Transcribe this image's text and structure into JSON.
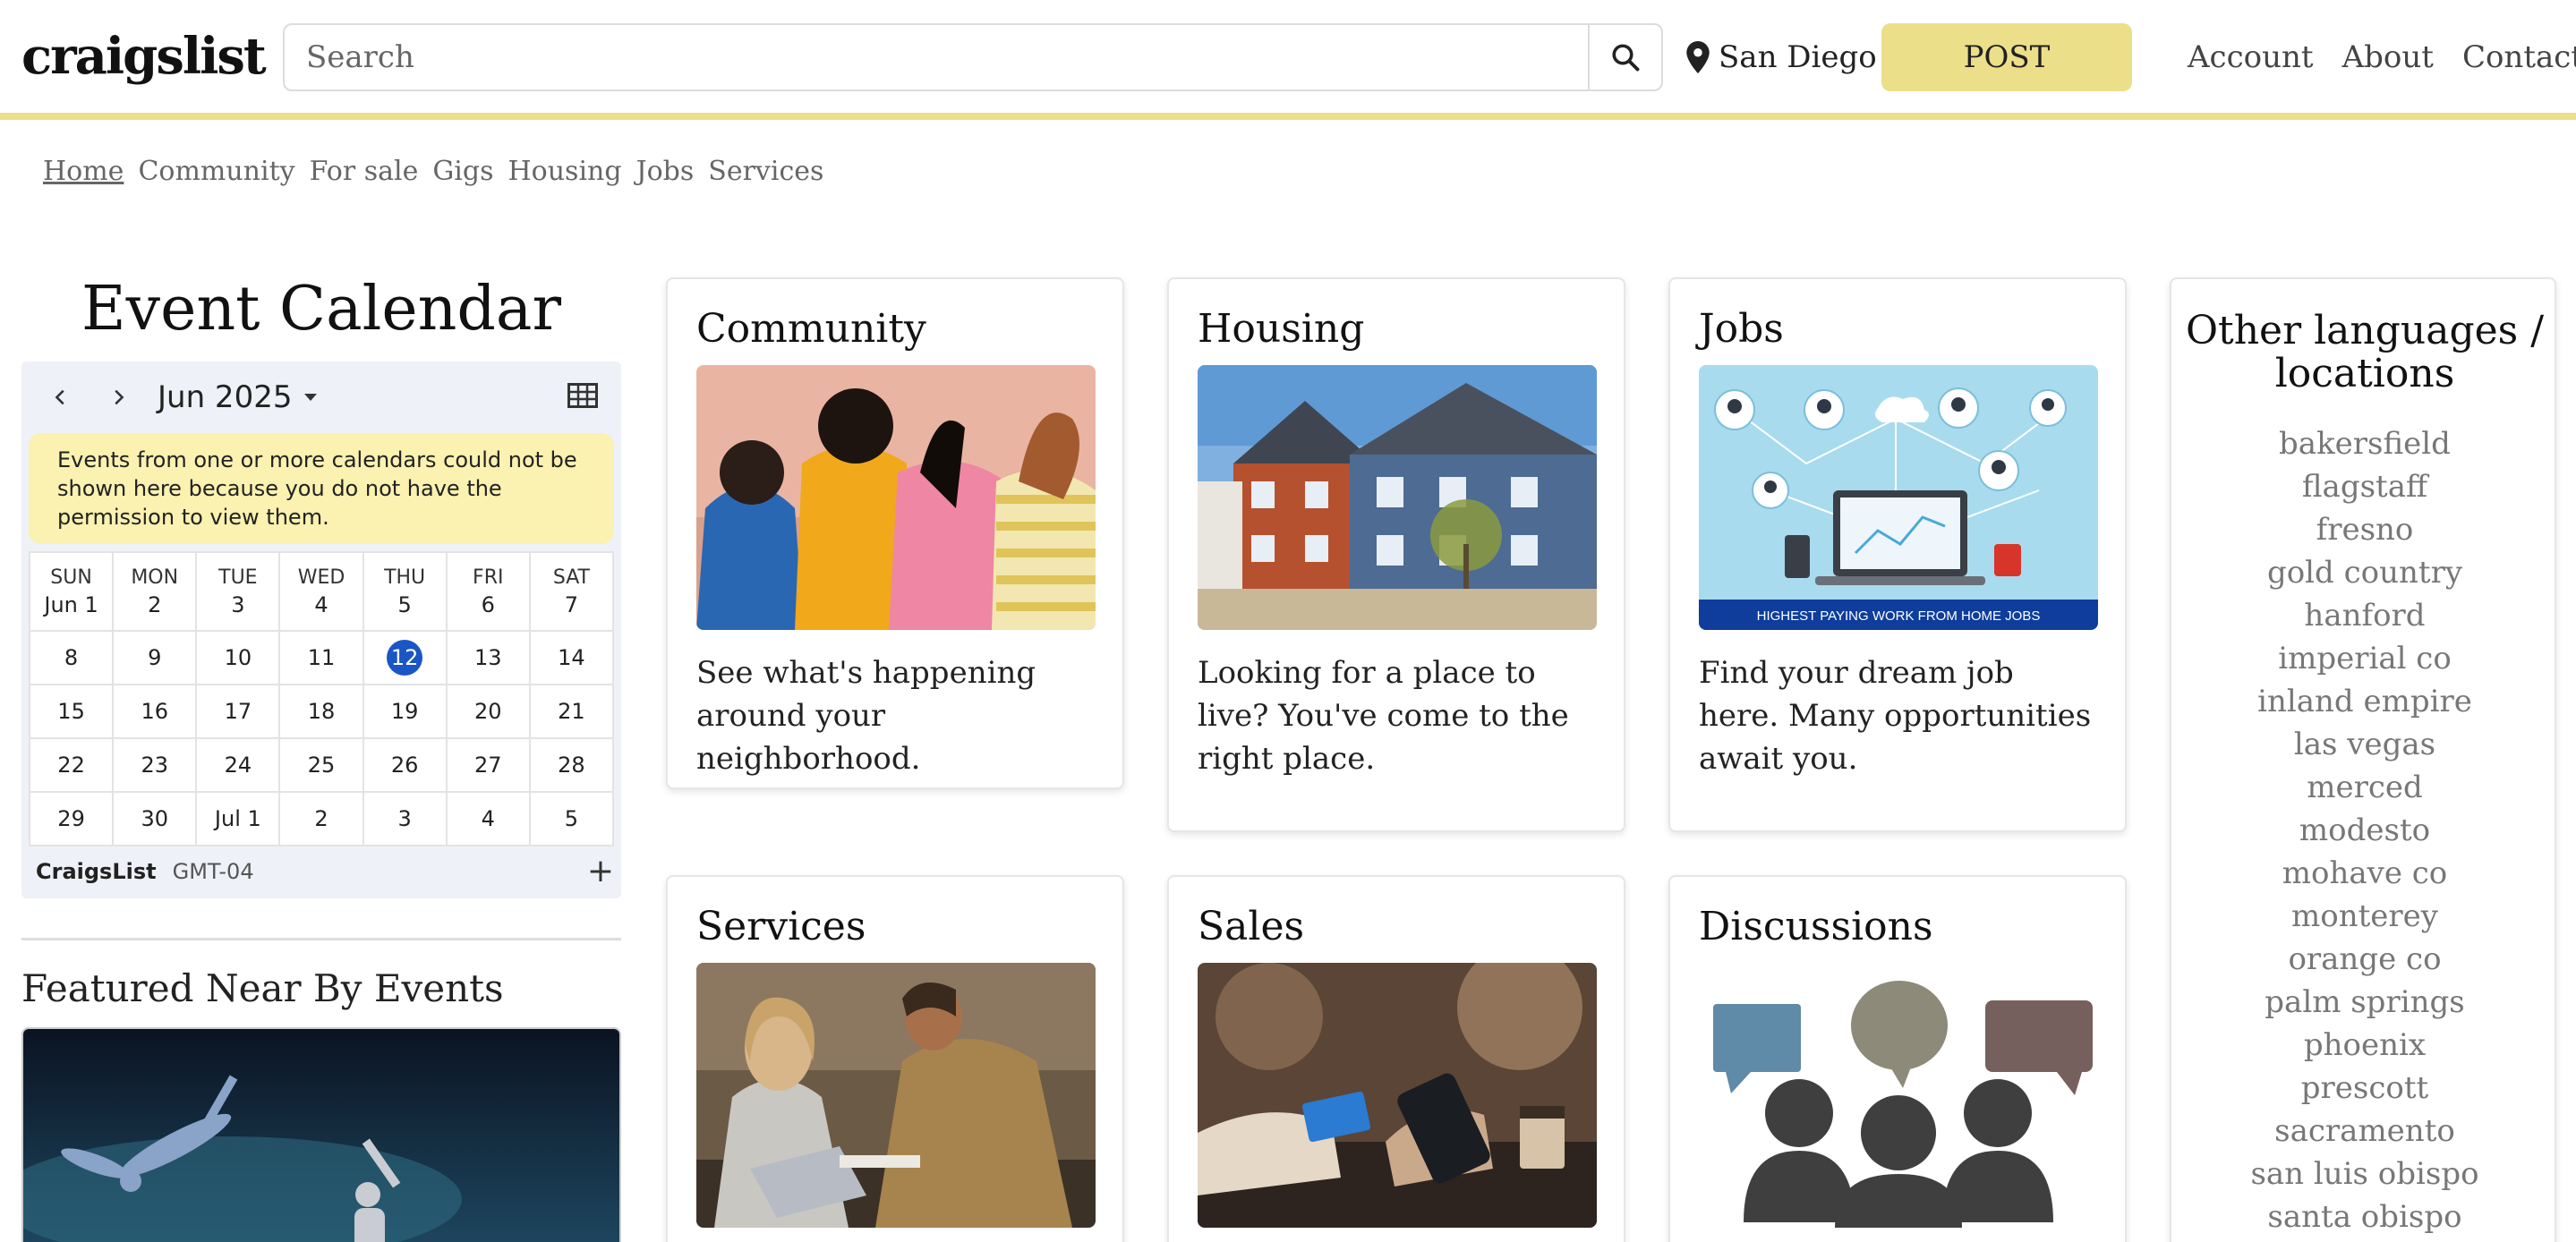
{
  "header": {
    "logo": "craigslist",
    "search_placeholder": "Search",
    "location": "San Diego",
    "post_label": "POST",
    "links": [
      "Account",
      "About",
      "Contact"
    ]
  },
  "nav": {
    "items": [
      "Home",
      "Community",
      "For sale",
      "Gigs",
      "Housing",
      "Jobs",
      "Services"
    ]
  },
  "calendar": {
    "title": "Event Calendar",
    "month": "Jun 2025",
    "warning": "Events from one or more calendars could not be shown here because you do not have the permission to view them.",
    "day_names": [
      "SUN",
      "MON",
      "TUE",
      "WED",
      "THU",
      "FRI",
      "SAT"
    ],
    "first_row": [
      "Jun 1",
      "2",
      "3",
      "4",
      "5",
      "6",
      "7"
    ],
    "weeks": [
      [
        "8",
        "9",
        "10",
        "11",
        "12",
        "13",
        "14"
      ],
      [
        "15",
        "16",
        "17",
        "18",
        "19",
        "20",
        "21"
      ],
      [
        "22",
        "23",
        "24",
        "25",
        "26",
        "27",
        "28"
      ],
      [
        "29",
        "30",
        "Jul 1",
        "2",
        "3",
        "4",
        "5"
      ]
    ],
    "today": "12",
    "calendar_name": "CraigsList",
    "timezone": "GMT-04",
    "add_label": "+"
  },
  "featured": {
    "title": "Featured Near By Events"
  },
  "cards": [
    {
      "title": "Community",
      "desc": "See what's happening around your neighborhood."
    },
    {
      "title": "Housing",
      "desc": "Looking for a place to live? You've come to the right place."
    },
    {
      "title": "Jobs",
      "desc": "Find your dream job here. Many opportunities await you.",
      "banner": "HIGHEST PAYING WORK FROM HOME JOBS"
    },
    {
      "title": "Services",
      "desc": ""
    },
    {
      "title": "Sales",
      "desc": ""
    },
    {
      "title": "Discussions",
      "desc": ""
    }
  ],
  "languages": {
    "title": "Other languages / locations",
    "items": [
      "bakersfield",
      "flagstaff",
      "fresno",
      "gold country",
      "hanford",
      "imperial co",
      "inland empire",
      "las vegas",
      "merced",
      "modesto",
      "mohave co",
      "monterey",
      "orange co",
      "palm springs",
      "phoenix",
      "prescott",
      "sacramento",
      "san luis obispo",
      "santa obispo"
    ]
  },
  "colors": {
    "accent_yellow": "#ecdf8a",
    "warning_bg": "#fbf1b0",
    "today_blue": "#1a56c4",
    "link_gray": "#777777"
  }
}
